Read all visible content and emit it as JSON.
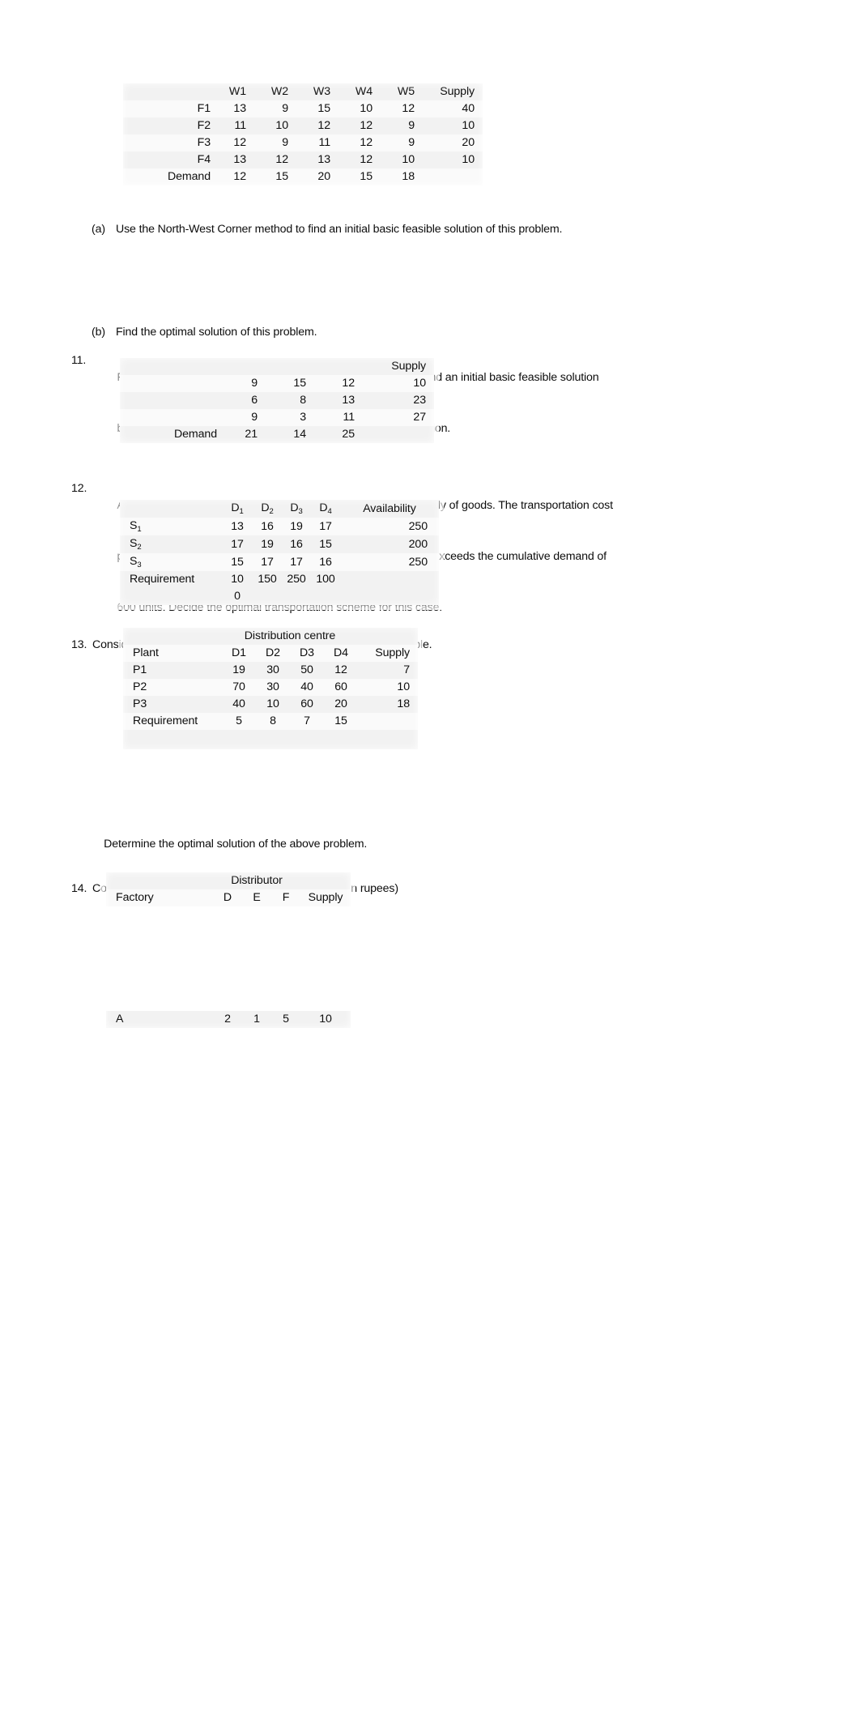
{
  "document": {
    "type": "exercise-worksheet",
    "topic": "Transportation problems"
  },
  "table_q10": {
    "headers": [
      "",
      "W1",
      "W2",
      "W3",
      "W4",
      "W5",
      "Supply"
    ],
    "rows": [
      {
        "label": "F1",
        "values": [
          "13",
          "9",
          "15",
          "10",
          "12"
        ],
        "supply": "40"
      },
      {
        "label": "F2",
        "values": [
          "11",
          "10",
          "12",
          "12",
          "9"
        ],
        "supply": "10"
      },
      {
        "label": "F3",
        "values": [
          "12",
          "9",
          "11",
          "12",
          "9"
        ],
        "supply": "20"
      },
      {
        "label": "F4",
        "values": [
          "13",
          "12",
          "13",
          "12",
          "10"
        ],
        "supply": "10"
      }
    ],
    "footer": {
      "label": "Demand",
      "values": [
        "12",
        "15",
        "20",
        "15",
        "18"
      ],
      "supply": ""
    }
  },
  "item_10a": {
    "marker": "(a)",
    "text": "Use the North-West Corner method to find an initial basic feasible solution of this problem."
  },
  "item_10b": {
    "marker": "(b)",
    "text": "Find the optimal solution of this problem."
  },
  "item_11": {
    "marker": "11.",
    "line1": "For the transportation problem given by the following tableau, find an initial basic feasible solution",
    "line2": "by the North-West corner method and then find an optimal solution."
  },
  "table_q11": {
    "headers": [
      "",
      "",
      "",
      "",
      "Supply"
    ],
    "rows": [
      {
        "label": "",
        "values": [
          "9",
          "15",
          "12"
        ],
        "supply": "10"
      },
      {
        "label": "",
        "values": [
          "6",
          "8",
          "13"
        ],
        "supply": "23"
      },
      {
        "label": "",
        "values": [
          "9",
          "3",
          "11"
        ],
        "supply": "27"
      }
    ],
    "footer": {
      "label": "Demand",
      "values": [
        "21",
        "14",
        "25"
      ],
      "supply": ""
    }
  },
  "item_12": {
    "marker": "12.",
    "line1": "An organization has four destinations and three sources for supply of goods. The transportation cost",
    "line2": "per unit is given below. The entire availability is 700 units which exceeds the cumulative demand of",
    "line3": "600 units. Decide the optimal transportation scheme for this case."
  },
  "table_q12": {
    "headers": [
      "",
      "D1",
      "D2",
      "D3",
      "D4",
      "Availability"
    ],
    "header_subs": [
      "",
      "1",
      "2",
      "3",
      "4",
      ""
    ],
    "header_bases": [
      "",
      "D",
      "D",
      "D",
      "D",
      "Availability"
    ],
    "rows": [
      {
        "base": "S",
        "sub": "1",
        "values": [
          "13",
          "16",
          "19",
          "17"
        ],
        "availability": "250"
      },
      {
        "base": "S",
        "sub": "2",
        "values": [
          "17",
          "19",
          "16",
          "15"
        ],
        "availability": "200"
      },
      {
        "base": "S",
        "sub": "3",
        "values": [
          "15",
          "17",
          "17",
          "16"
        ],
        "availability": "250"
      }
    ],
    "footer": {
      "label": "Requirement",
      "values": [
        "10",
        "150",
        "250",
        "100"
      ],
      "availability": ""
    },
    "footer_wrap": "0"
  },
  "item_13": {
    "marker": "13.",
    "text": "Consider the transportation problem presented in the following table."
  },
  "table_q13": {
    "group_header": "Distribution centre",
    "headers": [
      "Plant",
      "D1",
      "D2",
      "D3",
      "D4",
      "Supply"
    ],
    "rows": [
      {
        "label": "P1",
        "values": [
          "19",
          "30",
          "50",
          "12"
        ],
        "supply": "7"
      },
      {
        "label": "P2",
        "values": [
          "70",
          "30",
          "40",
          "60"
        ],
        "supply": "10"
      },
      {
        "label": "P3",
        "values": [
          "40",
          "10",
          "60",
          "20"
        ],
        "supply": "18"
      }
    ],
    "footer": {
      "label": "Requirement",
      "values": [
        "5",
        "8",
        "7",
        "15"
      ],
      "supply": ""
    }
  },
  "item_13_tail": {
    "text": "Determine the optimal solution of the above problem."
  },
  "item_14": {
    "marker": "14.",
    "text": "Consider the following transportation problem (cost in rupees)"
  },
  "table_q14": {
    "group_header": "Distributor",
    "headers": [
      "Factory",
      "D",
      "E",
      "F",
      "Supply"
    ],
    "rows": [
      {
        "label": "A",
        "values": [
          "2",
          "1",
          "5"
        ],
        "supply": "10"
      }
    ]
  }
}
